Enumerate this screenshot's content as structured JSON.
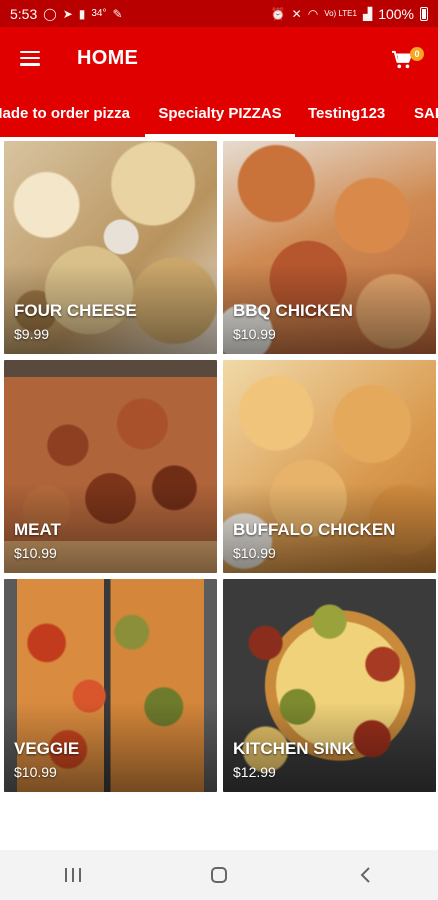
{
  "status_bar": {
    "time": "5:53",
    "temperature": "34°",
    "network": "Vo) LTE1",
    "battery": "100%"
  },
  "app_bar": {
    "title": "HOME",
    "cart_count": "0",
    "colors": {
      "primary": "#e00000",
      "status": "#b80000",
      "badge": "#f5a623"
    }
  },
  "tabs": [
    {
      "label": "Made to order pizza",
      "active": false
    },
    {
      "label": "Specialty PIZZAS",
      "active": true
    },
    {
      "label": "Testing123",
      "active": false
    },
    {
      "label": "SAL",
      "active": false
    }
  ],
  "products": [
    {
      "name": "FOUR CHEESE",
      "price": "$9.99"
    },
    {
      "name": "BBQ CHICKEN",
      "price": "$10.99"
    },
    {
      "name": "MEAT",
      "price": "$10.99"
    },
    {
      "name": "BUFFALO CHICKEN",
      "price": "$10.99"
    },
    {
      "name": "VEGGIE",
      "price": "$10.99"
    },
    {
      "name": "KITCHEN SINK",
      "price": "$12.99"
    }
  ],
  "nav": {
    "recents_icon": "recents-icon",
    "home_icon": "home-icon",
    "back_icon": "back-icon"
  }
}
